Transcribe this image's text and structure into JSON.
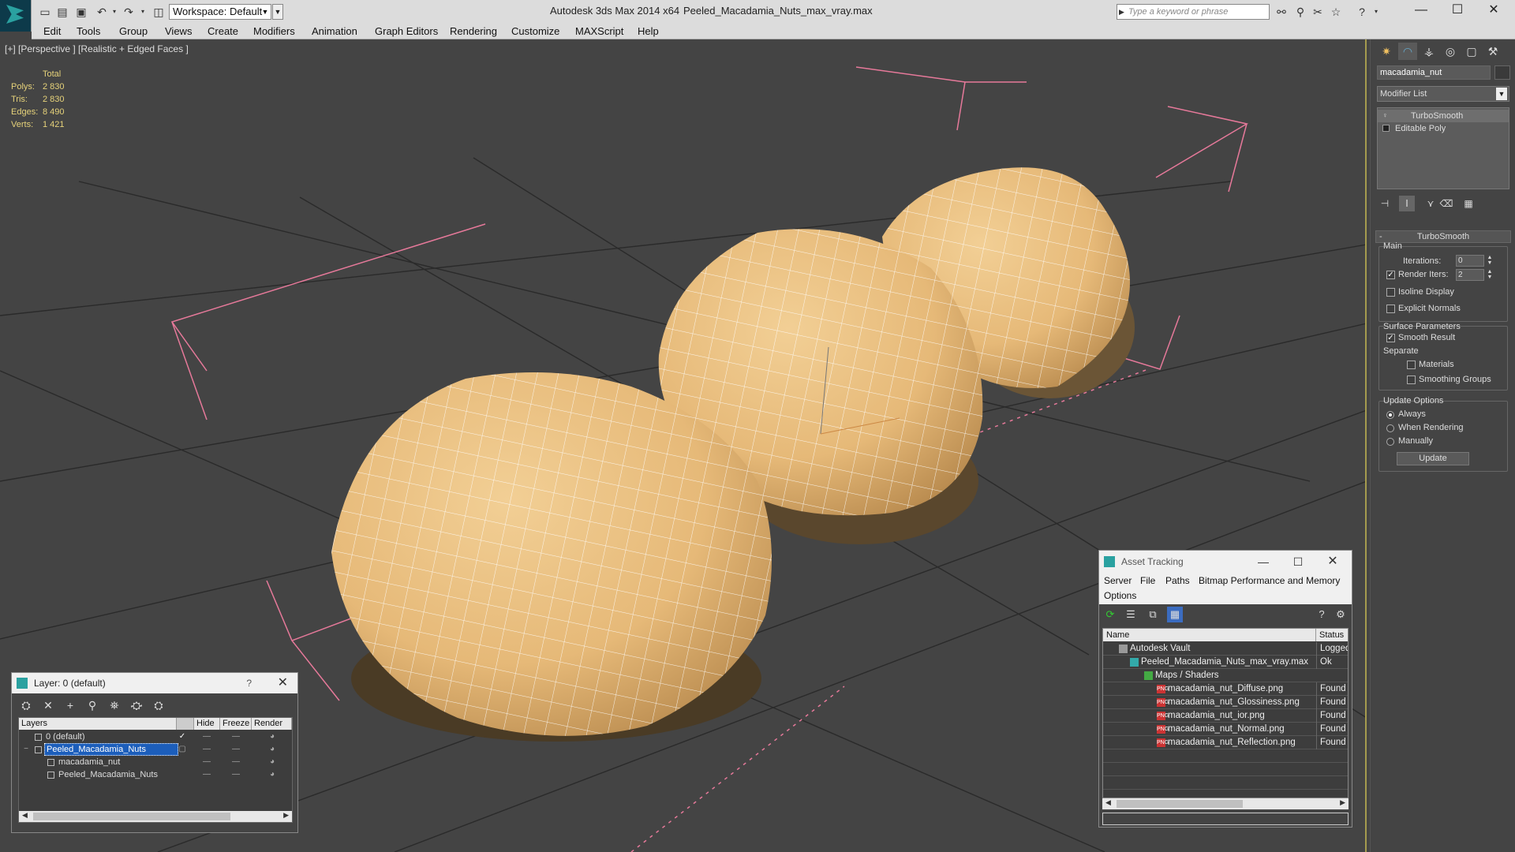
{
  "titlebar": {
    "app_title": "Autodesk 3ds Max  2014 x64",
    "file_title": "Peeled_Macadamia_Nuts_max_vray.max",
    "workspace": "Workspace: Default",
    "search_placeholder": "Type a keyword or phrase"
  },
  "menu": [
    "Edit",
    "Tools",
    "Group",
    "Views",
    "Create",
    "Modifiers",
    "Animation",
    "Graph Editors",
    "Rendering",
    "Customize",
    "MAXScript",
    "Help"
  ],
  "viewport": {
    "label": "[+] [Perspective ] [Realistic + Edged Faces ]",
    "stats_header": "Total",
    "stats": [
      {
        "k": "Polys:",
        "v": "2 830"
      },
      {
        "k": "Tris:",
        "v": "2 830"
      },
      {
        "k": "Edges:",
        "v": "8 490"
      },
      {
        "k": "Verts:",
        "v": "1 421"
      }
    ]
  },
  "command_panel": {
    "object_name": "macadamia_nut",
    "modifier_list": "Modifier List",
    "stack": [
      "TurboSmooth",
      "Editable Poly"
    ],
    "rollout_title": "TurboSmooth",
    "main_label": "Main",
    "iterations_label": "Iterations:",
    "iterations_value": "0",
    "render_iters_label": "Render Iters:",
    "render_iters_value": "2",
    "isoline_display": "Isoline Display",
    "explicit_normals": "Explicit Normals",
    "surface_params": "Surface Parameters",
    "smooth_result": "Smooth Result",
    "separate": "Separate",
    "materials": "Materials",
    "smoothing_groups": "Smoothing Groups",
    "update_options": "Update Options",
    "always": "Always",
    "when_rendering": "When Rendering",
    "manually": "Manually",
    "update_button": "Update"
  },
  "layer_window": {
    "title": "Layer: 0 (default)",
    "help": "?",
    "col_layers": "Layers",
    "col_hide": "Hide",
    "col_freeze": "Freeze",
    "col_render": "Render",
    "rows": [
      {
        "name": "0 (default)",
        "indent": 0
      },
      {
        "name": "Peeled_Macadamia_Nuts",
        "indent": 0
      },
      {
        "name": "macadamia_nut",
        "indent": 1
      },
      {
        "name": "Peeled_Macadamia_Nuts",
        "indent": 1
      }
    ]
  },
  "asset_window": {
    "title": "Asset Tracking",
    "menu": [
      "Server",
      "File",
      "Paths",
      "Bitmap Performance and Memory",
      "Options"
    ],
    "col_name": "Name",
    "col_status": "Status",
    "rows": [
      {
        "name": "Autodesk Vault",
        "status": "Logged",
        "indent": 1,
        "icon": "vault"
      },
      {
        "name": "Peeled_Macadamia_Nuts_max_vray.max",
        "status": "Ok",
        "indent": 2,
        "icon": "max"
      },
      {
        "name": "Maps / Shaders",
        "status": "",
        "indent": 3,
        "icon": "folder"
      },
      {
        "name": "macadamia_nut_Diffuse.png",
        "status": "Found",
        "indent": 4,
        "icon": "png"
      },
      {
        "name": "macadamia_nut_Glossiness.png",
        "status": "Found",
        "indent": 4,
        "icon": "png"
      },
      {
        "name": "macadamia_nut_ior.png",
        "status": "Found",
        "indent": 4,
        "icon": "png"
      },
      {
        "name": "macadamia_nut_Normal.png",
        "status": "Found",
        "indent": 4,
        "icon": "png"
      },
      {
        "name": "macadamia_nut_Reflection.png",
        "status": "Found",
        "indent": 4,
        "icon": "png"
      }
    ]
  }
}
